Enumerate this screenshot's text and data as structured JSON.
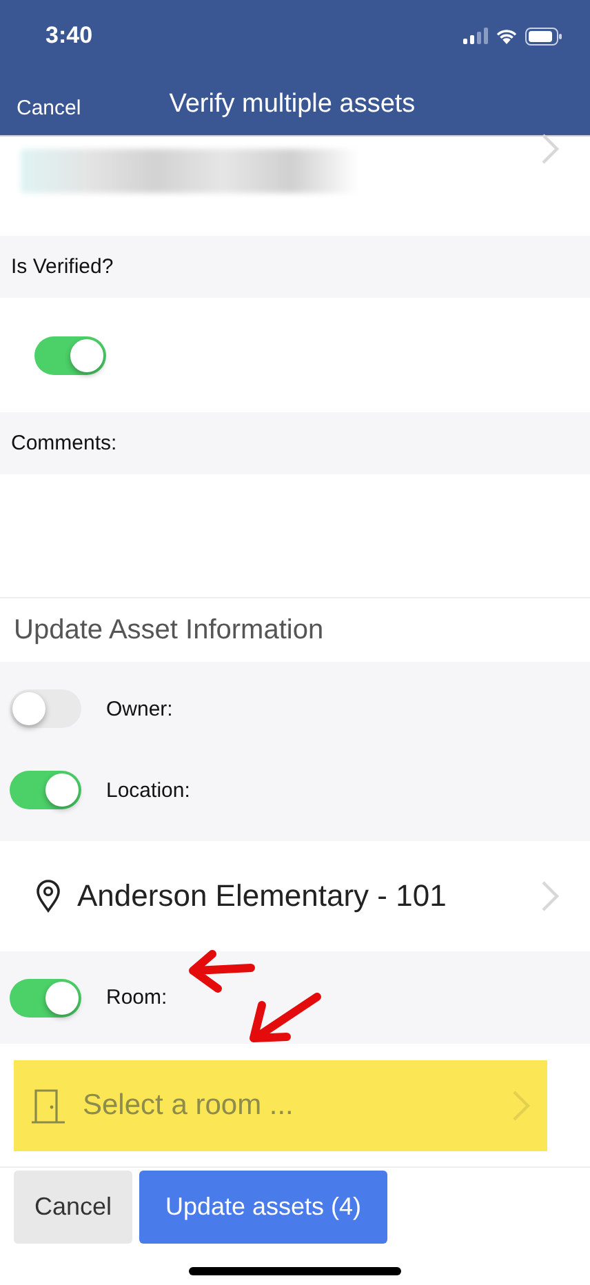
{
  "status_bar": {
    "time": "3:40"
  },
  "nav": {
    "cancel": "Cancel",
    "title": "Verify multiple assets"
  },
  "verified": {
    "label": "Is Verified?",
    "on": true
  },
  "comments": {
    "label": "Comments:"
  },
  "update_section": {
    "title": "Update Asset Information",
    "toggles": [
      {
        "label": "Owner:",
        "on": false
      },
      {
        "label": "Location:",
        "on": true
      }
    ]
  },
  "location": {
    "value": "Anderson Elementary - 101"
  },
  "room": {
    "label": "Room:",
    "on": true,
    "placeholder": "Select a room ..."
  },
  "buttons": [
    {
      "label": "Cancel",
      "kind": "secondary"
    },
    {
      "label": "Update assets (4)",
      "kind": "primary"
    }
  ]
}
